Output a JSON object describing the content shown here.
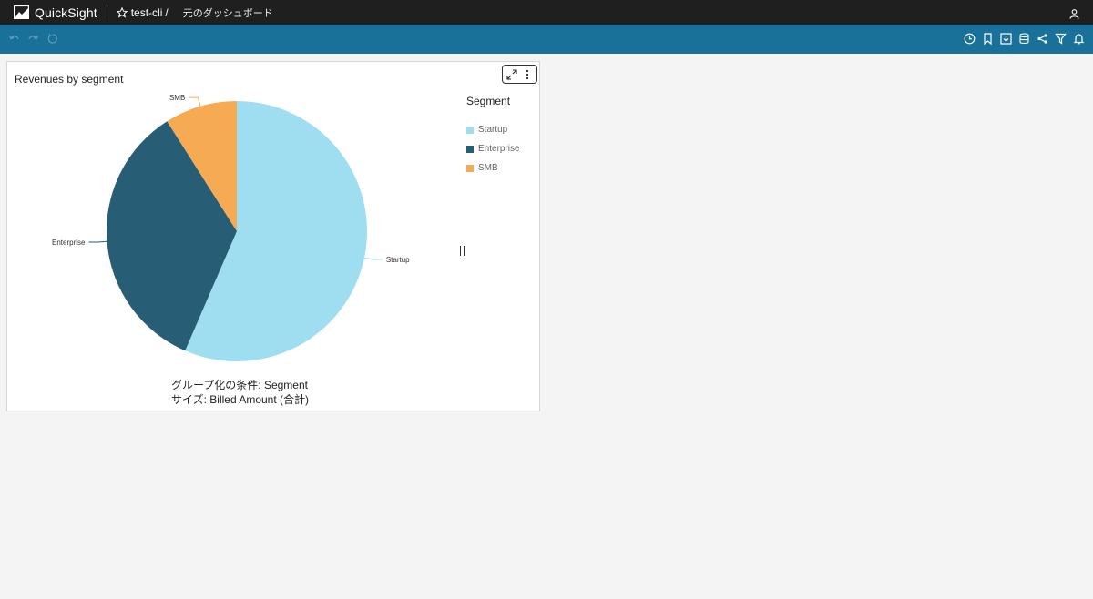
{
  "app": {
    "name": "QuickSight"
  },
  "breadcrumb": {
    "analysis": "test-cli",
    "separator": "/",
    "dashboard": "元のダッシュボード"
  },
  "icons": {
    "logo": "quicksight-logo-icon",
    "favorite": "star-icon",
    "user": "user-icon",
    "undo": "undo-icon",
    "redo": "redo-icon",
    "reset": "reset-icon",
    "toolbar_right": [
      "clock-icon",
      "bookmark-icon",
      "download-icon",
      "dataset-icon",
      "share-icon",
      "filter-icon",
      "bell-icon"
    ],
    "expand": "expand-icon",
    "menu": "more-vert-icon"
  },
  "colors": {
    "topbar": "#1f1f1f",
    "toolbar": "#19719a",
    "accent": "#19719a"
  },
  "visual": {
    "title": "Revenues by segment",
    "legend_title": "Segment",
    "field_wells": [
      "グループ化の条件: Segment",
      "サイズ: Billed Amount (合計)"
    ]
  },
  "chart_data": {
    "type": "pie",
    "title": "Revenues by segment",
    "categories": [
      "Startup",
      "Enterprise",
      "SMB"
    ],
    "values": [
      56.5,
      34.5,
      9
    ],
    "colors": [
      "#9fdef0",
      "#275d75",
      "#f7aa54"
    ],
    "legend": {
      "title": "Segment",
      "position": "right",
      "entries": [
        "Startup",
        "Enterprise",
        "SMB"
      ]
    }
  }
}
